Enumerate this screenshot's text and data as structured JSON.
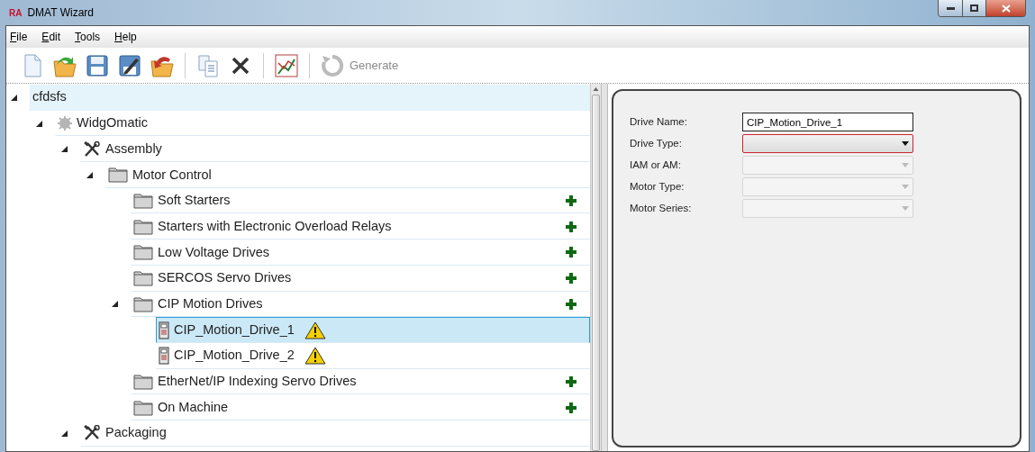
{
  "window": {
    "logo": "RA",
    "title": "DMAT Wizard"
  },
  "menu": [
    "File",
    "Edit",
    "Tools",
    "Help"
  ],
  "toolbar": [
    {
      "kind": "new",
      "disabled": false
    },
    {
      "kind": "open",
      "disabled": false
    },
    {
      "kind": "save",
      "disabled": false
    },
    {
      "kind": "saveas",
      "disabled": false
    },
    {
      "kind": "revert",
      "disabled": false
    },
    {
      "kind": "separator"
    },
    {
      "kind": "copy",
      "disabled": false
    },
    {
      "kind": "delete",
      "disabled": false
    },
    {
      "kind": "separator"
    },
    {
      "kind": "chart",
      "disabled": false
    },
    {
      "kind": "separator"
    },
    {
      "kind": "generate",
      "label": "Generate",
      "disabled": true
    }
  ],
  "tree": [
    {
      "label": "cfdsfs",
      "kind": "root",
      "expanded": true,
      "selected": false,
      "hovered": true,
      "children": [
        {
          "label": "WidgOmatic",
          "kind": "plant",
          "expanded": true,
          "selected": false,
          "hovered": false,
          "children": [
            {
              "label": "Assembly",
              "kind": "area",
              "expanded": true,
              "selected": false,
              "hovered": false,
              "children": [
                {
                  "label": "Motor Control",
                  "kind": "folder",
                  "expanded": true,
                  "selected": false,
                  "hovered": false,
                  "addable": false,
                  "children": [
                    {
                      "label": "Soft Starters",
                      "kind": "folder",
                      "selected": false,
                      "hovered": false,
                      "addable": true
                    },
                    {
                      "label": "Starters with Electronic Overload Relays",
                      "kind": "folder",
                      "selected": false,
                      "hovered": false,
                      "addable": true
                    },
                    {
                      "label": "Low Voltage Drives",
                      "kind": "folder",
                      "selected": false,
                      "hovered": false,
                      "addable": true
                    },
                    {
                      "label": "SERCOS Servo Drives",
                      "kind": "folder",
                      "selected": false,
                      "hovered": false,
                      "addable": true
                    },
                    {
                      "label": "CIP Motion Drives",
                      "kind": "folder",
                      "expanded": true,
                      "selected": false,
                      "hovered": false,
                      "addable": true,
                      "children": [
                        {
                          "label": "CIP_Motion_Drive_1",
                          "kind": "drive",
                          "selected": true,
                          "hovered": false,
                          "warning": true
                        },
                        {
                          "label": "CIP_Motion_Drive_2",
                          "kind": "drive",
                          "selected": false,
                          "hovered": false,
                          "warning": true
                        }
                      ]
                    },
                    {
                      "label": "EtherNet/IP Indexing Servo Drives",
                      "kind": "folder",
                      "selected": false,
                      "hovered": false,
                      "addable": true
                    },
                    {
                      "label": "On Machine",
                      "kind": "folder",
                      "selected": false,
                      "hovered": false,
                      "addable": true
                    }
                  ]
                }
              ]
            },
            {
              "label": "Packaging",
              "kind": "area",
              "expanded": true,
              "selected": false,
              "hovered": false
            }
          ]
        }
      ]
    }
  ],
  "form": [
    {
      "label": "Drive Name:",
      "kind": "text",
      "value": "CIP_Motion_Drive_1",
      "disabled": false,
      "invalid": false
    },
    {
      "label": "Drive Type:",
      "kind": "select",
      "disabled": false,
      "invalid": true
    },
    {
      "label": "IAM or AM:",
      "kind": "select",
      "disabled": true,
      "invalid": false
    },
    {
      "label": "Motor Type:",
      "kind": "select",
      "disabled": true,
      "invalid": false
    },
    {
      "label": "Motor Series:",
      "kind": "select",
      "disabled": true,
      "invalid": false
    }
  ]
}
